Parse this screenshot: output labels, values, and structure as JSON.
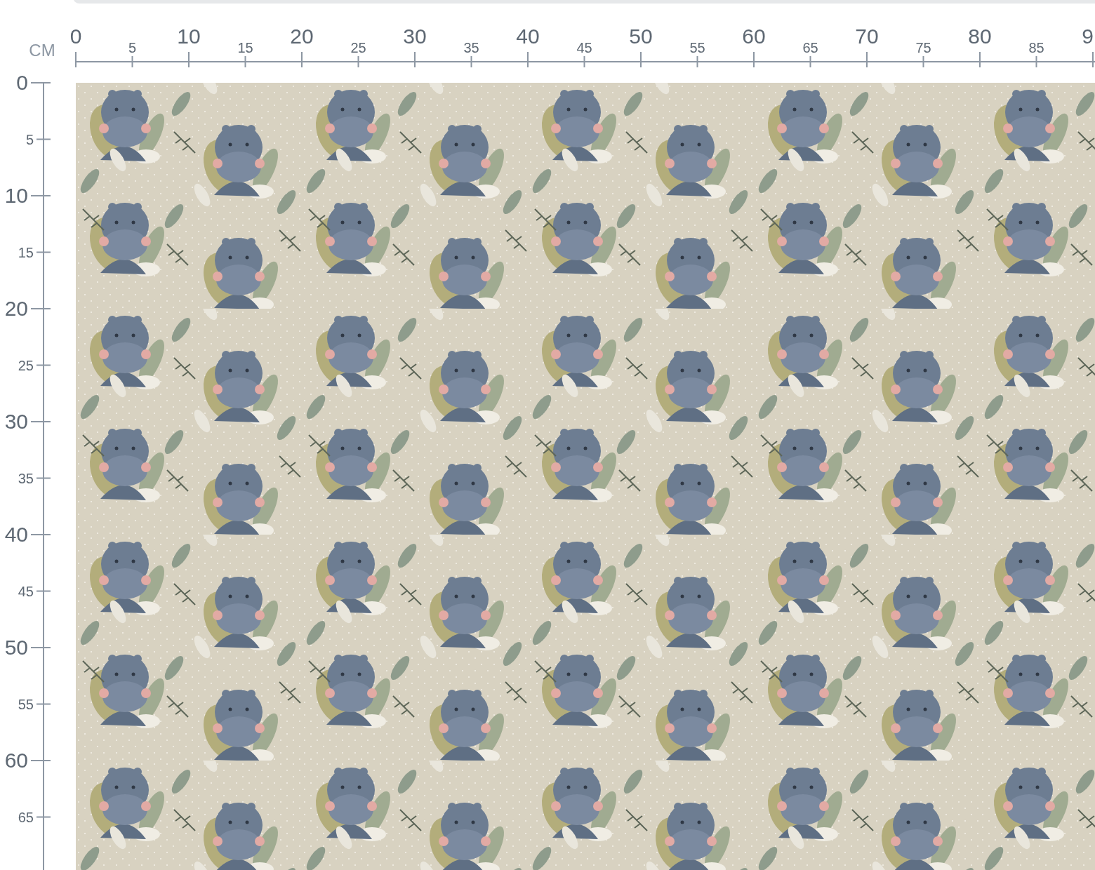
{
  "units": "CM",
  "top_ruler": {
    "labels": [
      {
        "text": "0",
        "major": true
      },
      {
        "text": "5",
        "major": false
      },
      {
        "text": "10",
        "major": true
      },
      {
        "text": "15",
        "major": false
      },
      {
        "text": "20",
        "major": true
      },
      {
        "text": "25",
        "major": false
      },
      {
        "text": "30",
        "major": true
      },
      {
        "text": "35",
        "major": false
      },
      {
        "text": "40",
        "major": true
      },
      {
        "text": "45",
        "major": false
      },
      {
        "text": "50",
        "major": true
      },
      {
        "text": "55",
        "major": false
      },
      {
        "text": "60",
        "major": true
      },
      {
        "text": "65",
        "major": false
      },
      {
        "text": "70",
        "major": true
      },
      {
        "text": "75",
        "major": false
      },
      {
        "text": "80",
        "major": true
      },
      {
        "text": "85",
        "major": false
      },
      {
        "text": "9",
        "major": true
      }
    ]
  },
  "left_ruler": {
    "labels": [
      {
        "text": "0",
        "major": true
      },
      {
        "text": "5",
        "major": false
      },
      {
        "text": "10",
        "major": true
      },
      {
        "text": "15",
        "major": false
      },
      {
        "text": "20",
        "major": true
      },
      {
        "text": "25",
        "major": false
      },
      {
        "text": "30",
        "major": true
      },
      {
        "text": "35",
        "major": false
      },
      {
        "text": "40",
        "major": true
      },
      {
        "text": "45",
        "major": false
      },
      {
        "text": "50",
        "major": true
      },
      {
        "text": "55",
        "major": false
      },
      {
        "text": "60",
        "major": true
      },
      {
        "text": "65",
        "major": false
      }
    ]
  }
}
